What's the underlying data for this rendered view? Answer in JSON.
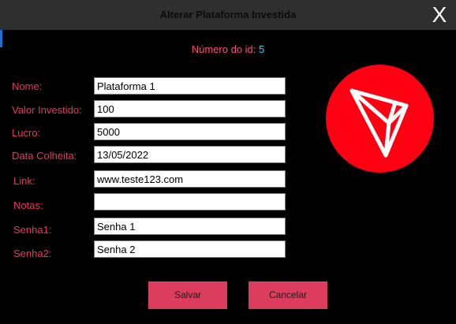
{
  "window": {
    "title": "Alterar Plataforma Investida",
    "close_label": "X"
  },
  "header": {
    "id_label": "Número do id:",
    "id_value": "5"
  },
  "form": {
    "fields": [
      {
        "label": "Nome:",
        "value": "Plataforma 1"
      },
      {
        "label": "Valor Investido:",
        "value": "100"
      },
      {
        "label": "Lucro:",
        "value": "5000"
      },
      {
        "label": "Data Colheita:",
        "value": "13/05/2022"
      },
      {
        "label": "Link:",
        "value": "www.teste123.com"
      },
      {
        "label": "Notas:",
        "value": ""
      },
      {
        "label": "Senha1:",
        "value": "Senha 1"
      },
      {
        "label": "Senha2:",
        "value": "Senha 2"
      }
    ]
  },
  "logo": {
    "icon": "tron-logo-icon",
    "color": "#ff0013"
  },
  "buttons": {
    "save_label": "Salvar",
    "cancel_label": "Cancelar"
  },
  "colors": {
    "label": "#e8365f",
    "id_value": "#2bd4ff",
    "button": "#dc3d5d",
    "titlebar": "#2f2f2f"
  }
}
